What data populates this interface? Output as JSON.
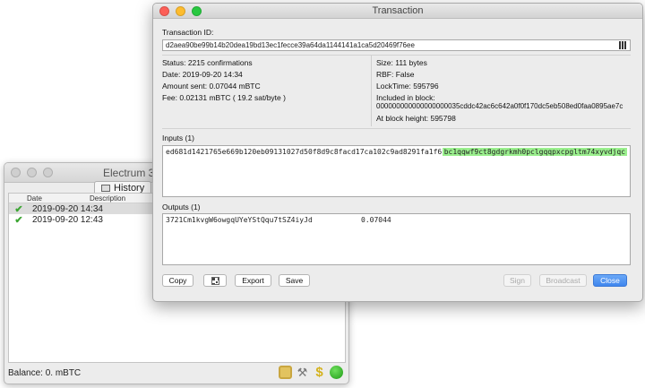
{
  "background_window": {
    "title": "Electrum 3.3.8",
    "tab_history": "History",
    "columns": {
      "date": "Date",
      "description": "Description"
    },
    "rows": [
      {
        "date": "2019-09-20 14:34"
      },
      {
        "date": "2019-09-20 12:43"
      }
    ],
    "balance": "Balance: 0. mBTC",
    "icons": [
      "lock-icon",
      "tools-icon",
      "dollar-icon",
      "network-status-icon"
    ]
  },
  "tx_window": {
    "title": "Transaction",
    "txid_label": "Transaction ID:",
    "txid": "d2aea90be99b14b20dea19bd13ec1fecce39a64da1144141a1ca5d20469f76ee",
    "status": "Status: 2215 confirmations",
    "date": "Date: 2019-09-20 14:34",
    "amount": "Amount sent: 0.07044 mBTC",
    "fee": "Fee: 0.02131 mBTC  ( 19.2 sat/byte )",
    "size": "Size: 111 bytes",
    "rbf": "RBF: False",
    "locktime": "LockTime: 595796",
    "included_label": "Included in block:",
    "block_hash": "000000000000000000035cddc42ac6c642a0f0f170dc5eb508ed0faa0895ae7c",
    "block_height": "At block height: 595798",
    "inputs_label": "Inputs (1)",
    "input": {
      "prevout": "ed681d1421765e669b120eb09131027d50f8d9c8facd17ca102c9ad8291fa1f6:1",
      "address": "bc1qqwf9ct8gdgrkmh0pclgqqpxcpgltm74xyvdjqc"
    },
    "outputs_label": "Outputs (1)",
    "output": {
      "address": "3721Cm1kvgW6owgqUYeYStQqu7tSZ4iyJd",
      "amount": "0.07044"
    },
    "buttons": {
      "copy": "Copy",
      "export": "Export",
      "save": "Save",
      "sign": "Sign",
      "broadcast": "Broadcast",
      "close": "Close"
    },
    "colors": {
      "accent": "#3f86ee",
      "input_highlight": "#9bf08e"
    }
  }
}
